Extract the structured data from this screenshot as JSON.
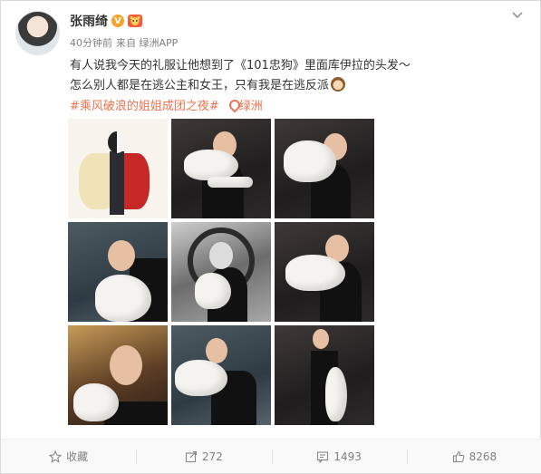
{
  "post": {
    "author": "张雨绮",
    "verified_badge": "V",
    "vip_badge": "🐯",
    "time": "40分钟前",
    "source": "来自 绿洲APP",
    "text_line1": "有人说我今天的礼服让他想到了《101忠狗》里面库伊拉的头发～",
    "text_line2": "怎么别人都是在逃公主和女王，只有我是在逃反派",
    "hashtag": "#乘风破浪的姐姐成团之夜#",
    "location": "绿洲"
  },
  "actions": {
    "favorite": "收藏",
    "repost": "272",
    "comment": "1493",
    "like": "8268"
  },
  "colors": {
    "accent": "#eb7350",
    "text": "#333333",
    "meta": "#808080"
  },
  "icons": {
    "menu": "chevron-down-icon",
    "favorite": "star-icon",
    "repost": "share-icon",
    "comment": "comment-icon",
    "like": "thumb-up-icon",
    "location": "location-pin-icon"
  }
}
